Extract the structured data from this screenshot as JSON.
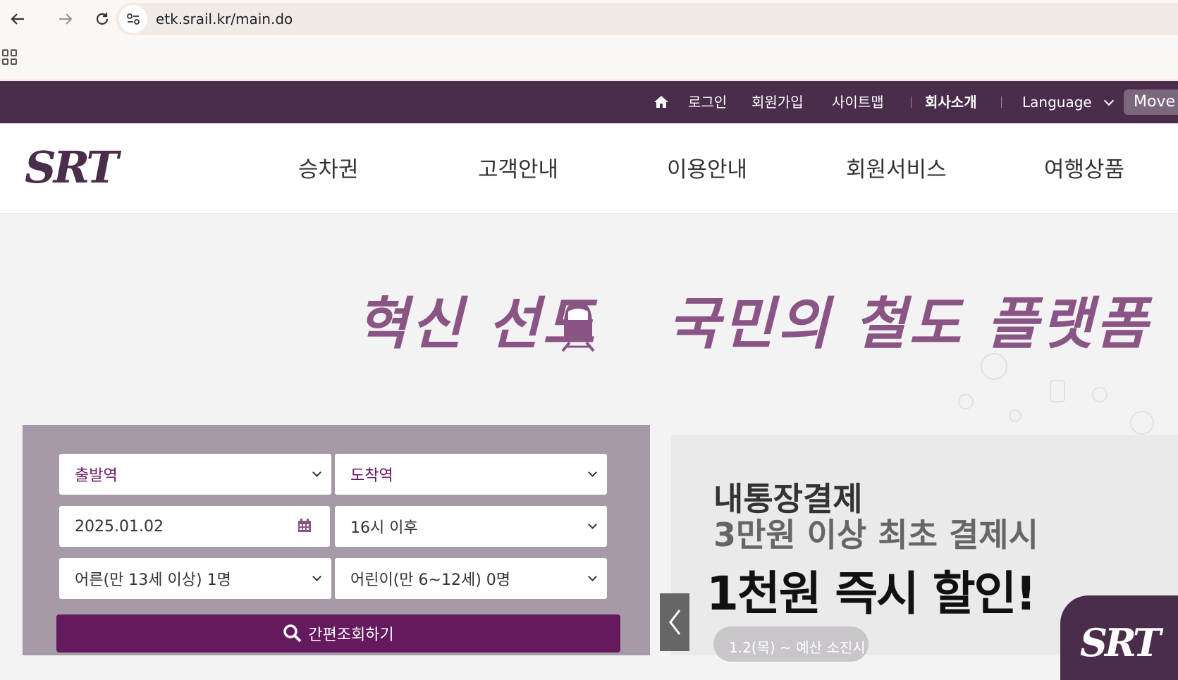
{
  "browser": {
    "url": "etk.srail.kr/main.do"
  },
  "util_nav": {
    "login": "로그인",
    "signup": "회원가입",
    "sitemap": "사이트맵",
    "company": "회사소개",
    "language": "Language",
    "move": "Move"
  },
  "gnb": {
    "items": [
      "승차권",
      "고객안내",
      "이용안내",
      "회원서비스",
      "여행상품"
    ]
  },
  "hero": {
    "slogan_left": "혁신 선도",
    "slogan_right": "국민의 철도 플랫폼"
  },
  "search": {
    "departure": "출발역",
    "arrival": "도착역",
    "date": "2025.01.02",
    "time": "16시 이후",
    "adult": "어른(만 13세 이상) 1명",
    "child": "어린이(만 6~12세) 0명",
    "button": "간편조회하기"
  },
  "banner": {
    "line1": "내통장결제",
    "line2": "3만원 이상 최초 결제시",
    "line3": "1천원 즉시 할인!",
    "pill": "1.2(목) ~ 예산 소진시"
  },
  "colors": {
    "brand": "#4a2c4b",
    "accent": "#651a5e",
    "panel": "#a69aa6"
  }
}
